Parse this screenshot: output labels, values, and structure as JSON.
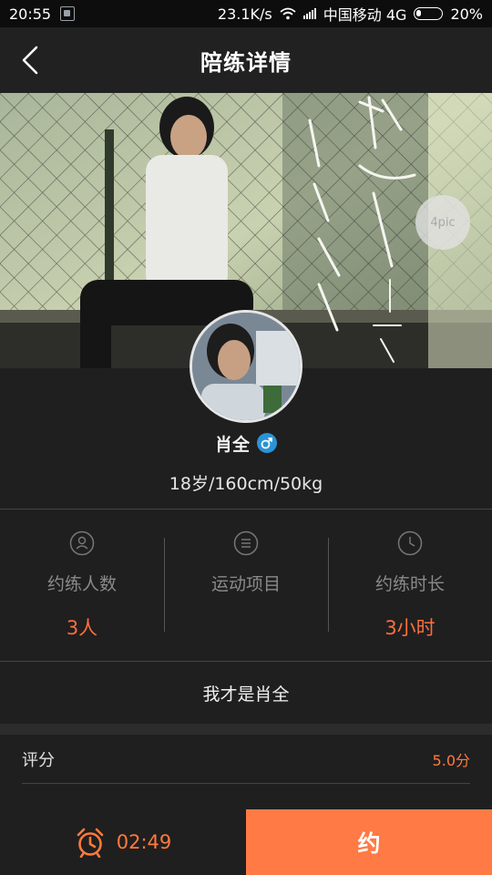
{
  "status_bar": {
    "time": "20:55",
    "network_speed": "23.1K/s",
    "carrier": "中国移动 4G",
    "battery": "20%",
    "icons": [
      "sim-icon",
      "wifi-icon",
      "signal-icon",
      "battery-icon"
    ]
  },
  "header": {
    "title": "陪练详情",
    "back_icon": "back-arrow-icon"
  },
  "banner": {
    "pic_count": "4pic"
  },
  "profile": {
    "name": "肖全",
    "gender_icon": "male-icon",
    "meta": "18岁/160cm/50kg"
  },
  "stats": [
    {
      "icon": "person-icon",
      "label": "约练人数",
      "value": "3人"
    },
    {
      "icon": "list-icon",
      "label": "运动项目",
      "value": ""
    },
    {
      "icon": "clock-icon",
      "label": "约练时长",
      "value": "3小时"
    }
  ],
  "bio": "我才是肖全",
  "rating": {
    "label": "评分",
    "value": "5.0分"
  },
  "bottom": {
    "timer_icon": "alarm-clock-icon",
    "timer": "02:49",
    "book_label": "约"
  },
  "colors": {
    "accent": "#ff7a45",
    "background": "#1f1f1f",
    "gender_blue": "#2a94d6"
  }
}
